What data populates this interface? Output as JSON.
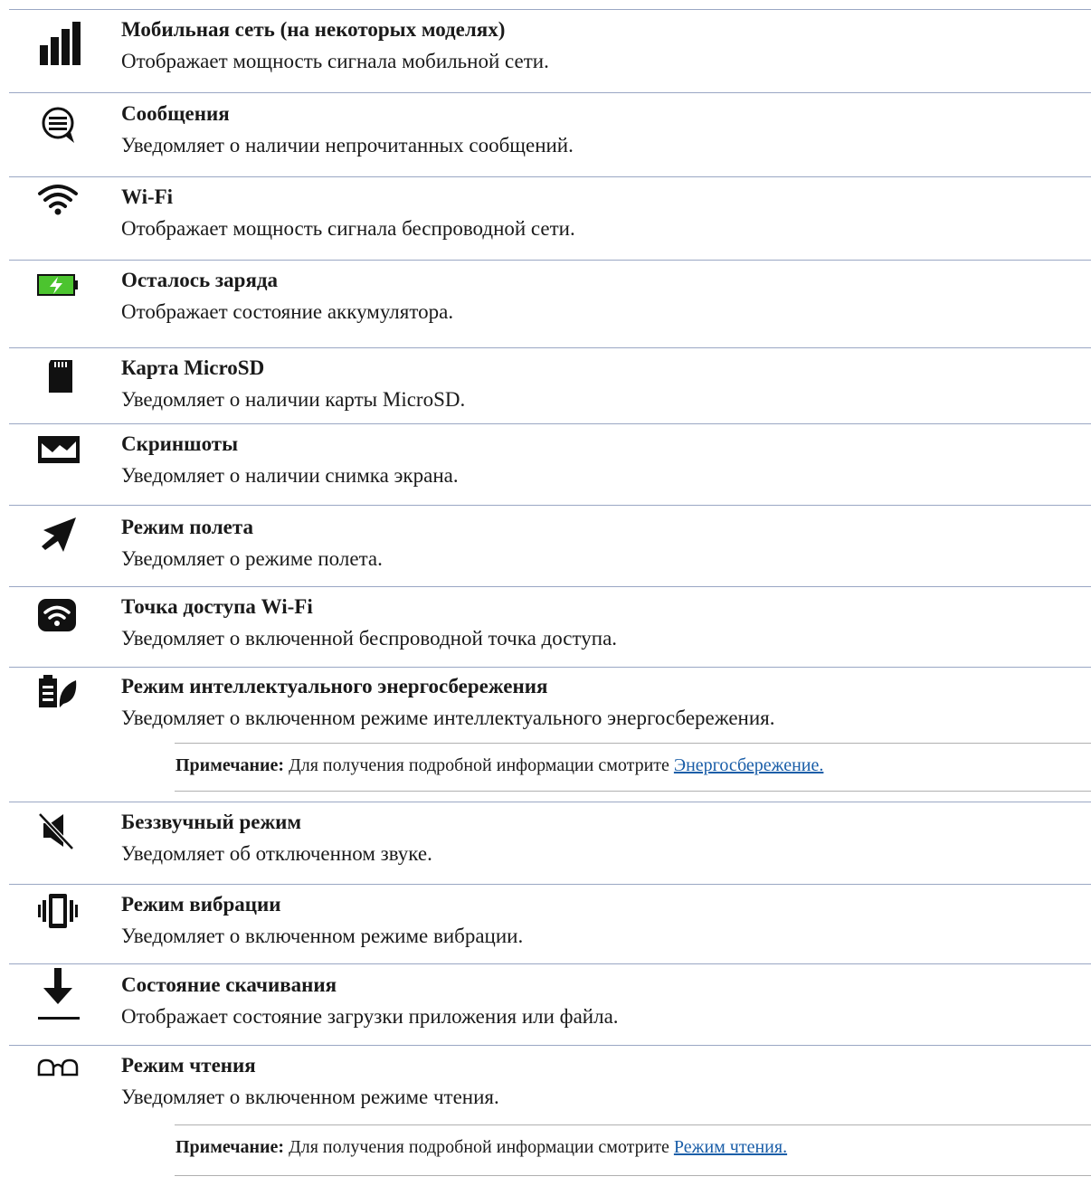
{
  "items": [
    {
      "icon": "signal-bars-icon",
      "title": "Мобильная сеть (на некоторых моделях)",
      "desc": "Отображает мощность сигнала мобильной сети."
    },
    {
      "icon": "message-icon",
      "title": "Сообщения",
      "desc": "Уведомляет о наличии непрочитанных сообщений."
    },
    {
      "icon": "wifi-icon",
      "title": "Wi-Fi",
      "desc": "Отображает мощность сигнала беспроводной сети."
    },
    {
      "icon": "battery-charging-icon",
      "title": "Осталось заряда",
      "desc": "Отображает состояние аккумулятора."
    },
    {
      "icon": "microsd-card-icon",
      "title": "Карта MicroSD",
      "desc": "Уведомляет о наличии карты MicroSD."
    },
    {
      "icon": "screenshot-icon",
      "title": "Скриншоты",
      "desc": "Уведомляет о наличии снимка экрана."
    },
    {
      "icon": "airplane-icon",
      "title": "Режим полета",
      "desc": "Уведомляет о режиме полета."
    },
    {
      "icon": "wifi-hotspot-icon",
      "title": "Точка доступа Wi-Fi",
      "desc": "Уведомляет о включенной беспроводной точка доступа."
    },
    {
      "icon": "power-saver-icon",
      "title": "Режим интеллектуального энергосбережения",
      "desc": "Уведомляет о включенном режиме интеллектуального энергосбережения."
    },
    {
      "icon": "silent-mode-icon",
      "title": "Беззвучный режим",
      "desc": "Уведомляет об отключенном звуке."
    },
    {
      "icon": "vibration-icon",
      "title": "Режим вибрации",
      "desc": "Уведомляет о включенном режиме вибрации."
    },
    {
      "icon": "download-icon",
      "title": "Состояние скачивания",
      "desc": "Отображает состояние загрузки приложения или файла."
    },
    {
      "icon": "reading-glasses-icon",
      "title": "Режим чтения",
      "desc": "Уведомляет о включенном режиме чтения."
    }
  ],
  "notes": [
    {
      "label": "Примечание:",
      "text": " Для получения подробной информации смотрите ",
      "link": "Энергосбережение."
    },
    {
      "label": "Примечание:",
      "text": " Для получения подробной информации смотрите ",
      "link": "Режим чтения."
    }
  ],
  "colors": {
    "rule": "#9aa7c4",
    "battery_fill": "#4cc42f",
    "link": "#1a5ea8"
  }
}
